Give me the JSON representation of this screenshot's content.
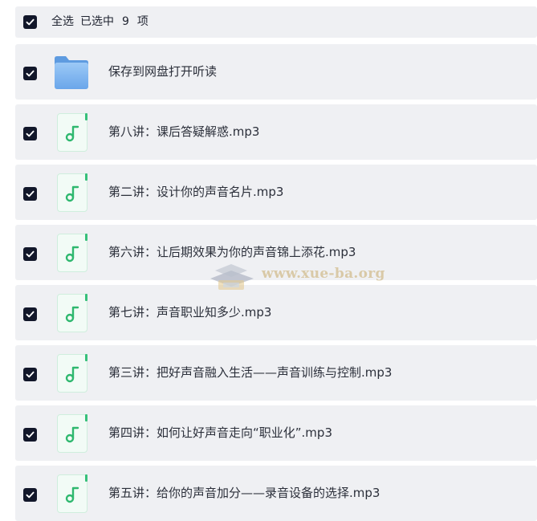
{
  "header": {
    "select_all_label": "全选",
    "selected_prefix": "已选中",
    "selected_count": "9",
    "selected_suffix": "项"
  },
  "items": [
    {
      "name": "保存到网盘打开听读",
      "type": "folder",
      "checked": true
    },
    {
      "name": "第八讲：课后答疑解惑.mp3",
      "type": "audio",
      "checked": true
    },
    {
      "name": "第二讲：设计你的声音名片.mp3",
      "type": "audio",
      "checked": true
    },
    {
      "name": "第六讲：让后期效果为你的声音锦上添花.mp3",
      "type": "audio",
      "checked": true
    },
    {
      "name": "第七讲：声音职业知多少.mp3",
      "type": "audio",
      "checked": true
    },
    {
      "name": "第三讲：把好声音融入生活——声音训练与控制.mp3",
      "type": "audio",
      "checked": true
    },
    {
      "name": "第四讲：如何让好声音走向“职业化”.mp3",
      "type": "audio",
      "checked": true
    },
    {
      "name": "第五讲：给你的声音加分——录音设备的选择.mp3",
      "type": "audio",
      "checked": true
    }
  ],
  "watermark": {
    "text": "www.xue-ba.org"
  },
  "colors": {
    "checkbox": "#12172a",
    "row_background": "#eff0f3",
    "audio_icon_accent": "#37c07a",
    "folder": "#7fb6f1"
  },
  "icons": {
    "folder": "folder-icon",
    "audio": "music-note-icon",
    "check": "checkmark-icon"
  }
}
